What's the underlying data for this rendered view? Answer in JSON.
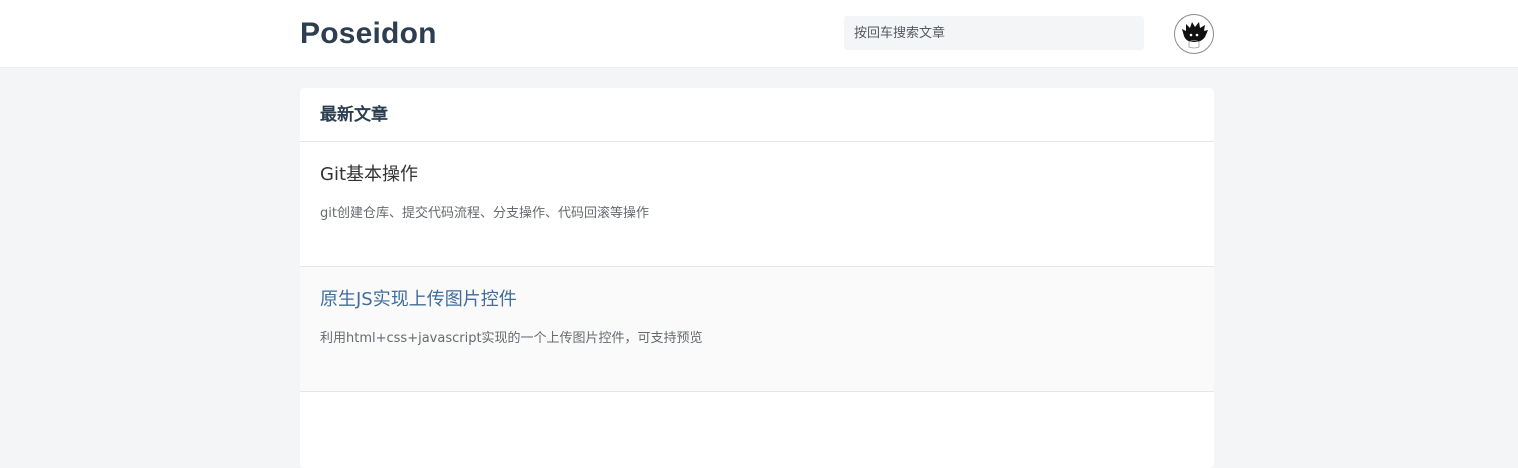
{
  "header": {
    "logo": "Poseidon",
    "search": {
      "placeholder": "按回车搜索文章",
      "value": ""
    },
    "avatar_icon": "avatar-icon"
  },
  "main": {
    "section_title": "最新文章",
    "articles": [
      {
        "title": "Git基本操作",
        "summary": "git创建仓库、提交代码流程、分支操作、代码回滚等操作"
      },
      {
        "title": "原生JS实现上传图片控件",
        "summary": "利用html+css+javascript实现的一个上传图片控件，可支持预览"
      }
    ]
  },
  "colors": {
    "page_background": "#f4f5f7",
    "logo_text": "#2c3e50",
    "link_hover": "#3e6d9e"
  }
}
